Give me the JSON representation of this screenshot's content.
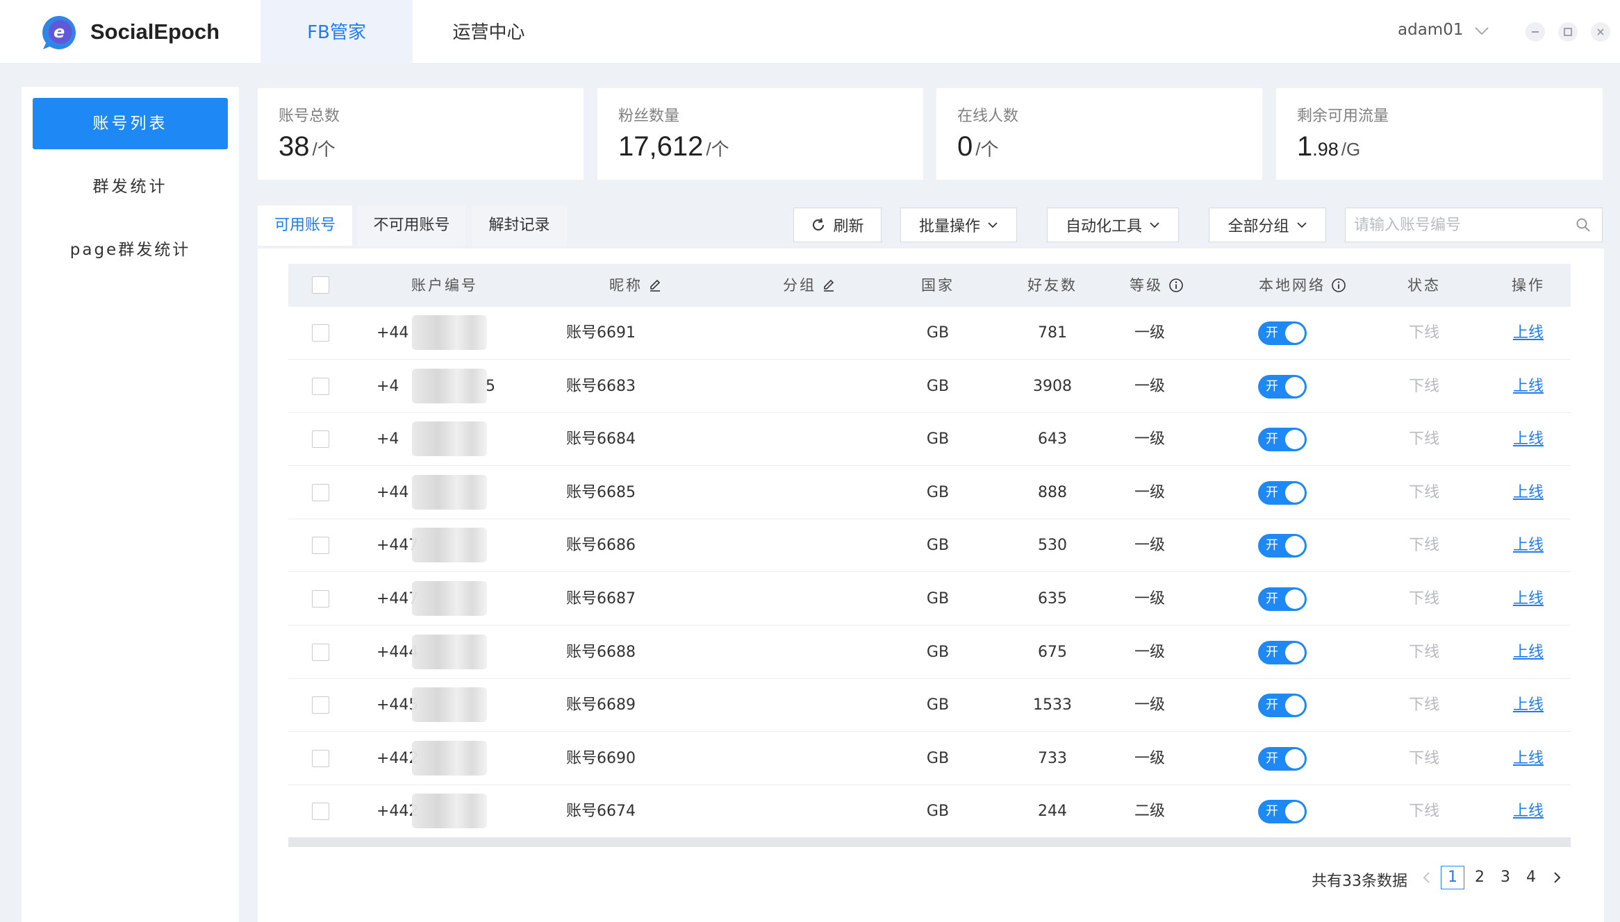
{
  "app": {
    "brand": "SocialEpoch",
    "user": "adam01"
  },
  "main_tabs": [
    {
      "label": "FB管家"
    },
    {
      "label": "运营中心"
    }
  ],
  "sidebar": {
    "items": [
      {
        "label": "账号列表"
      },
      {
        "label": "群发统计"
      },
      {
        "label": "page群发统计"
      }
    ]
  },
  "stats": [
    {
      "label": "账号总数",
      "value": "38",
      "unit": "/个"
    },
    {
      "label": "粉丝数量",
      "value": "17,612",
      "unit": "/个"
    },
    {
      "label": "在线人数",
      "value": "0",
      "unit": "/个"
    },
    {
      "label": "剩余可用流量",
      "value": "1",
      "decimal": ".98",
      "unit": "/G"
    }
  ],
  "sub_tabs": [
    {
      "label": "可用账号"
    },
    {
      "label": "不可用账号"
    },
    {
      "label": "解封记录"
    }
  ],
  "toolbar": {
    "refresh": "刷新",
    "batch": "批量操作",
    "auto": "自动化工具",
    "group": "全部分组",
    "search_placeholder": "请输入账号编号"
  },
  "table": {
    "columns": [
      "账户编号",
      "昵称",
      "分组",
      "国家",
      "好友数",
      "等级",
      "本地网络",
      "状态",
      "操作"
    ],
    "rows": [
      {
        "account": "+44",
        "nickname": "账号6691",
        "group": "",
        "country": "GB",
        "friends": "781",
        "level": "一级",
        "network": "开",
        "status": "下线",
        "action": "上线"
      },
      {
        "account": "+4",
        "account_suffix": "5",
        "nickname": "账号6683",
        "group": "",
        "country": "GB",
        "friends": "3908",
        "level": "一级",
        "network": "开",
        "status": "下线",
        "action": "上线"
      },
      {
        "account": "+4",
        "nickname": "账号6684",
        "group": "",
        "country": "GB",
        "friends": "643",
        "level": "一级",
        "network": "开",
        "status": "下线",
        "action": "上线"
      },
      {
        "account": "+44",
        "nickname": "账号6685",
        "group": "",
        "country": "GB",
        "friends": "888",
        "level": "一级",
        "network": "开",
        "status": "下线",
        "action": "上线"
      },
      {
        "account": "+447",
        "nickname": "账号6686",
        "group": "",
        "country": "GB",
        "friends": "530",
        "level": "一级",
        "network": "开",
        "status": "下线",
        "action": "上线"
      },
      {
        "account": "+447",
        "nickname": "账号6687",
        "group": "",
        "country": "GB",
        "friends": "635",
        "level": "一级",
        "network": "开",
        "status": "下线",
        "action": "上线"
      },
      {
        "account": "+444",
        "nickname": "账号6688",
        "group": "",
        "country": "GB",
        "friends": "675",
        "level": "一级",
        "network": "开",
        "status": "下线",
        "action": "上线"
      },
      {
        "account": "+445",
        "nickname": "账号6689",
        "group": "",
        "country": "GB",
        "friends": "1533",
        "level": "一级",
        "network": "开",
        "status": "下线",
        "action": "上线"
      },
      {
        "account": "+442",
        "nickname": "账号6690",
        "group": "",
        "country": "GB",
        "friends": "733",
        "level": "一级",
        "network": "开",
        "status": "下线",
        "action": "上线"
      },
      {
        "account": "+442",
        "nickname": "账号6674",
        "group": "",
        "country": "GB",
        "friends": "244",
        "level": "二级",
        "network": "开",
        "status": "下线",
        "action": "上线"
      }
    ]
  },
  "pagination": {
    "total_text": "共有33条数据",
    "pages": [
      "1",
      "2",
      "3",
      "4"
    ],
    "current": "1"
  },
  "colors": {
    "primary": "#1e88f5",
    "link": "#1e7cf0",
    "muted": "#b5b9c0"
  },
  "icons": [
    "logo-icon",
    "chevron-down-icon",
    "minimize-icon",
    "maximize-icon",
    "close-icon",
    "refresh-icon",
    "edit-icon",
    "info-icon",
    "search-icon",
    "chevron-left-icon",
    "chevron-right-icon"
  ]
}
